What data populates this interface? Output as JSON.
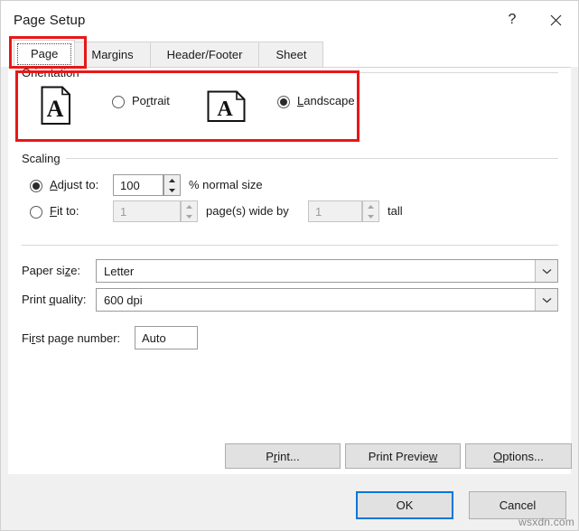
{
  "window": {
    "title": "Page Setup",
    "help_icon": "question-mark-icon",
    "close_icon": "close-icon"
  },
  "tabs": [
    {
      "label": "Page",
      "active": true
    },
    {
      "label": "Margins",
      "active": false
    },
    {
      "label": "Header/Footer",
      "active": false
    },
    {
      "label": "Sheet",
      "active": false
    }
  ],
  "orientation": {
    "group_label": "Orientation",
    "portrait": {
      "label_pre": "Po",
      "label_acc": "r",
      "label_post": "trait",
      "selected": false,
      "icon": "portrait-page-icon"
    },
    "landscape": {
      "label_pre": "",
      "label_acc": "L",
      "label_post": "andscape",
      "selected": true,
      "icon": "landscape-page-icon"
    },
    "highlight_color": "#e81717"
  },
  "scaling": {
    "group_label": "Scaling",
    "adjust_to": {
      "label_pre": "",
      "label_acc": "A",
      "label_post": "djust to:",
      "selected": true,
      "value": "100",
      "suffix": "% normal size"
    },
    "fit_to": {
      "label_pre": "",
      "label_acc": "F",
      "label_post": "it to:",
      "selected": false,
      "wide_value": "1",
      "middle_label": "page(s) wide by",
      "tall_value": "1",
      "tall_label": "tall",
      "disabled": true
    }
  },
  "paper_size": {
    "label_pre": "Paper si",
    "label_acc": "z",
    "label_post": "e:",
    "value": "Letter",
    "arrow_icon": "chevron-down-icon"
  },
  "print_quality": {
    "label_pre": "Print ",
    "label_acc": "q",
    "label_post": "uality:",
    "value": "600 dpi",
    "arrow_icon": "chevron-down-icon"
  },
  "first_page_number": {
    "label_pre": "Fi",
    "label_acc": "r",
    "label_post": "st page number:",
    "value": "Auto"
  },
  "action_buttons": {
    "print": {
      "pre": "P",
      "acc": "r",
      "post": "int..."
    },
    "print_preview": {
      "pre": "Print Previe",
      "acc": "w",
      "post": ""
    },
    "options": {
      "pre": "",
      "acc": "O",
      "post": "ptions..."
    }
  },
  "footer_buttons": {
    "ok": "OK",
    "cancel": "Cancel"
  },
  "watermark": "wsxdn.com",
  "colors": {
    "highlight": "#e81717",
    "focus_border": "#0078d7",
    "dialog_bg": "#f0f0f0",
    "content_bg": "#ffffff"
  }
}
